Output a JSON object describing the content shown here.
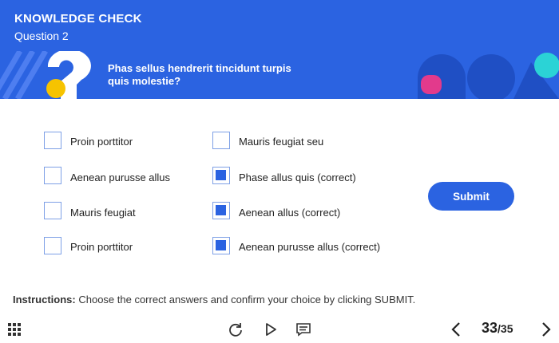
{
  "header": {
    "title": "KNOWLEDGE CHECK",
    "question_number": "Question 2",
    "question_text": "Phas sellus hendrerit tincidunt turpis quis molestie?"
  },
  "colors": {
    "brand_blue": "#2b63e1",
    "accent_yellow": "#f6c300",
    "accent_pink": "#e23a8c",
    "accent_cyan": "#2bd3d6"
  },
  "options": {
    "left": [
      {
        "label": "Proin porttitor",
        "checked": false
      },
      {
        "label": "Aenean purusse allus",
        "checked": false
      },
      {
        "label": "Mauris feugiat",
        "checked": false
      },
      {
        "label": "Proin porttitor",
        "checked": false
      }
    ],
    "right": [
      {
        "label": "Mauris feugiat seu",
        "checked": false
      },
      {
        "label": "Phase allus quis (correct)",
        "checked": true
      },
      {
        "label": "Aenean allus (correct)",
        "checked": true
      },
      {
        "label": "Aenean purusse allus (correct)",
        "checked": true
      }
    ]
  },
  "submit_label": "Submit",
  "instructions": {
    "prefix": "Instructions:",
    "text": " Choose the correct answers and confirm your choice by clicking SUBMIT."
  },
  "footer": {
    "icons": [
      "menu-grid-icon",
      "replay-icon",
      "play-icon",
      "transcript-icon",
      "prev-icon",
      "next-icon"
    ],
    "current_page": "33",
    "total_pages": "/35"
  }
}
